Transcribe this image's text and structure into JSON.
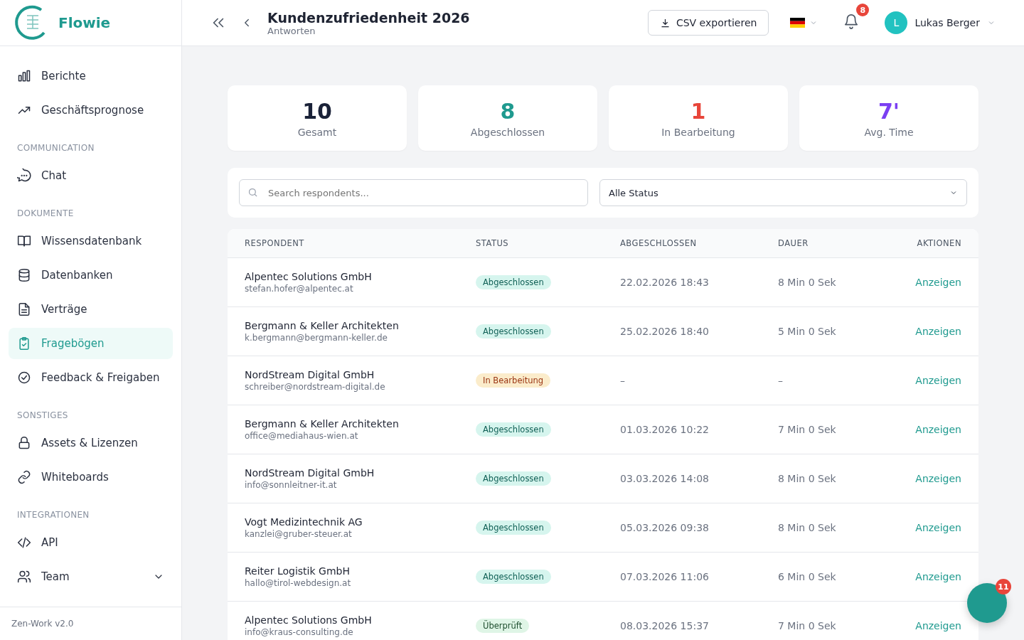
{
  "brand": {
    "name": "Flowie"
  },
  "sidebar": {
    "sections": [
      {
        "items": [
          {
            "label": "Berichte",
            "selected": false
          },
          {
            "label": "Geschäftsprognose",
            "selected": false
          }
        ]
      },
      {
        "heading": "COMMUNICATION",
        "items": [
          {
            "label": "Chat",
            "selected": false
          }
        ]
      },
      {
        "heading": "DOKUMENTE",
        "items": [
          {
            "label": "Wissensdatenbank",
            "selected": false
          },
          {
            "label": "Datenbanken",
            "selected": false
          },
          {
            "label": "Verträge",
            "selected": false
          },
          {
            "label": "Fragebögen",
            "selected": true
          },
          {
            "label": "Feedback & Freigaben",
            "selected": false
          }
        ]
      },
      {
        "heading": "SONSTIGES",
        "items": [
          {
            "label": "Assets & Lizenzen",
            "selected": false
          },
          {
            "label": "Whiteboards",
            "selected": false
          }
        ]
      },
      {
        "heading": "INTEGRATIONEN",
        "items": [
          {
            "label": "API",
            "selected": false
          },
          {
            "label": "Team",
            "selected": false,
            "expanded": false
          }
        ]
      }
    ],
    "version": "Zen-Work v2.0"
  },
  "header": {
    "title": "Kundenzufriedenheit 2026",
    "subtitle": "Antworten",
    "export_button": "CSV exportieren",
    "notifications": "8",
    "user": {
      "initial": "L",
      "name": "Lukas Berger"
    }
  },
  "stats": [
    {
      "value": "10",
      "label": "Gesamt",
      "color": "#1a2238"
    },
    {
      "value": "8",
      "label": "Abgeschlossen",
      "color": "#1f9a8f"
    },
    {
      "value": "1",
      "label": "In Bearbeitung",
      "color": "#e8453a"
    },
    {
      "value": "7'",
      "label": "Avg. Time",
      "color": "#7b3ff2"
    }
  ],
  "filters": {
    "search_placeholder": "Search respondents...",
    "status_select": "Alle Status"
  },
  "table": {
    "columns": [
      "RESPONDENT",
      "STATUS",
      "ABGESCHLOSSEN",
      "DAUER",
      "AKTIONEN"
    ],
    "rows": [
      {
        "name": "Alpentec Solutions GmbH",
        "email": "stefan.hofer@alpentec.at",
        "status": "Abgeschlossen",
        "kind": "done",
        "completed": "22.02.2026 18:43",
        "duration": "8 Min 0 Sek",
        "action": "Anzeigen"
      },
      {
        "name": "Bergmann & Keller Architekten",
        "email": "k.bergmann@bergmann-keller.de",
        "status": "Abgeschlossen",
        "kind": "done",
        "completed": "25.02.2026 18:40",
        "duration": "5 Min 0 Sek",
        "action": "Anzeigen"
      },
      {
        "name": "NordStream Digital GmbH",
        "email": "schreiber@nordstream-digital.de",
        "status": "In Bearbeitung",
        "kind": "progress",
        "completed": "–",
        "duration": "–",
        "action": "Anzeigen"
      },
      {
        "name": "Bergmann & Keller Architekten",
        "email": "office@mediahaus-wien.at",
        "status": "Abgeschlossen",
        "kind": "done",
        "completed": "01.03.2026 10:22",
        "duration": "7 Min 0 Sek",
        "action": "Anzeigen"
      },
      {
        "name": "NordStream Digital GmbH",
        "email": "info@sonnleitner-it.at",
        "status": "Abgeschlossen",
        "kind": "done",
        "completed": "03.03.2026 14:08",
        "duration": "8 Min 0 Sek",
        "action": "Anzeigen"
      },
      {
        "name": "Vogt Medizintechnik AG",
        "email": "kanzlei@gruber-steuer.at",
        "status": "Abgeschlossen",
        "kind": "done",
        "completed": "05.03.2026 09:38",
        "duration": "8 Min 0 Sek",
        "action": "Anzeigen"
      },
      {
        "name": "Reiter Logistik GmbH",
        "email": "hallo@tirol-webdesign.at",
        "status": "Abgeschlossen",
        "kind": "done",
        "completed": "07.03.2026 11:06",
        "duration": "6 Min 0 Sek",
        "action": "Anzeigen"
      },
      {
        "name": "Alpentec Solutions GmbH",
        "email": "info@kraus-consulting.de",
        "status": "Überprüft",
        "kind": "reviewed",
        "completed": "08.03.2026 15:37",
        "duration": "7 Min 0 Sek",
        "action": "Anzeigen"
      }
    ]
  },
  "chat_fab": {
    "badge": "11"
  }
}
